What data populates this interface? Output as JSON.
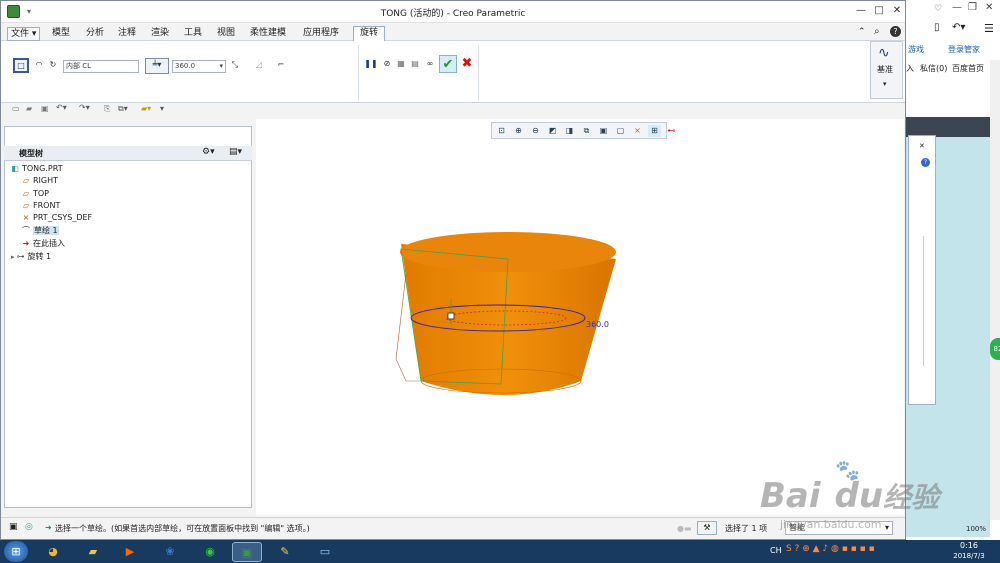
{
  "window": {
    "title": "TONG (活动的) - Creo Parametric",
    "controls": [
      "—",
      "□",
      "✕"
    ]
  },
  "menu": {
    "file": "文件",
    "tabs": [
      "模型",
      "分析",
      "注释",
      "渲染",
      "工具",
      "视图",
      "柔性建模",
      "应用程序"
    ],
    "active_tab": "旋转"
  },
  "ribbon": {
    "sketch_ref": "内部 CL",
    "angle_value": "360.0",
    "subtabs": [
      "放置",
      "选项",
      "属性"
    ],
    "datum_label": "基准"
  },
  "model_tree": {
    "header": "模型树",
    "items": [
      {
        "label": "TONG.PRT",
        "icon": "part-icon"
      },
      {
        "label": "RIGHT",
        "icon": "datum-plane-icon"
      },
      {
        "label": "TOP",
        "icon": "datum-plane-icon"
      },
      {
        "label": "FRONT",
        "icon": "datum-plane-icon"
      },
      {
        "label": "PRT_CSYS_DEF",
        "icon": "csys-icon"
      },
      {
        "label": "草绘 1",
        "icon": "sketch-icon"
      },
      {
        "label": "在此插入",
        "icon": "insert-arrow-icon"
      },
      {
        "label": "旋转 1",
        "icon": "revolve-icon"
      }
    ]
  },
  "graphics": {
    "dimension_label": "360.0"
  },
  "status": {
    "message": "选择一个草绘。(如果首选内部草绘，可在放置面板中找到 \"编辑\" 选项。)",
    "selection_count": "选择了 1 项",
    "filter": "智能"
  },
  "browser": {
    "links": [
      "游戏",
      "登录管家"
    ],
    "row2": [
      "入",
      "私信(0)",
      "百度首页"
    ],
    "badge": "82",
    "zoom": "100%"
  },
  "taskbar": {
    "lang": "CH",
    "time": "0:16",
    "date": "2018/7/3"
  },
  "watermark": {
    "brand": "Bai",
    "brand2": "du",
    "cn": "经验",
    "url": "jingyan.baidu.com"
  }
}
